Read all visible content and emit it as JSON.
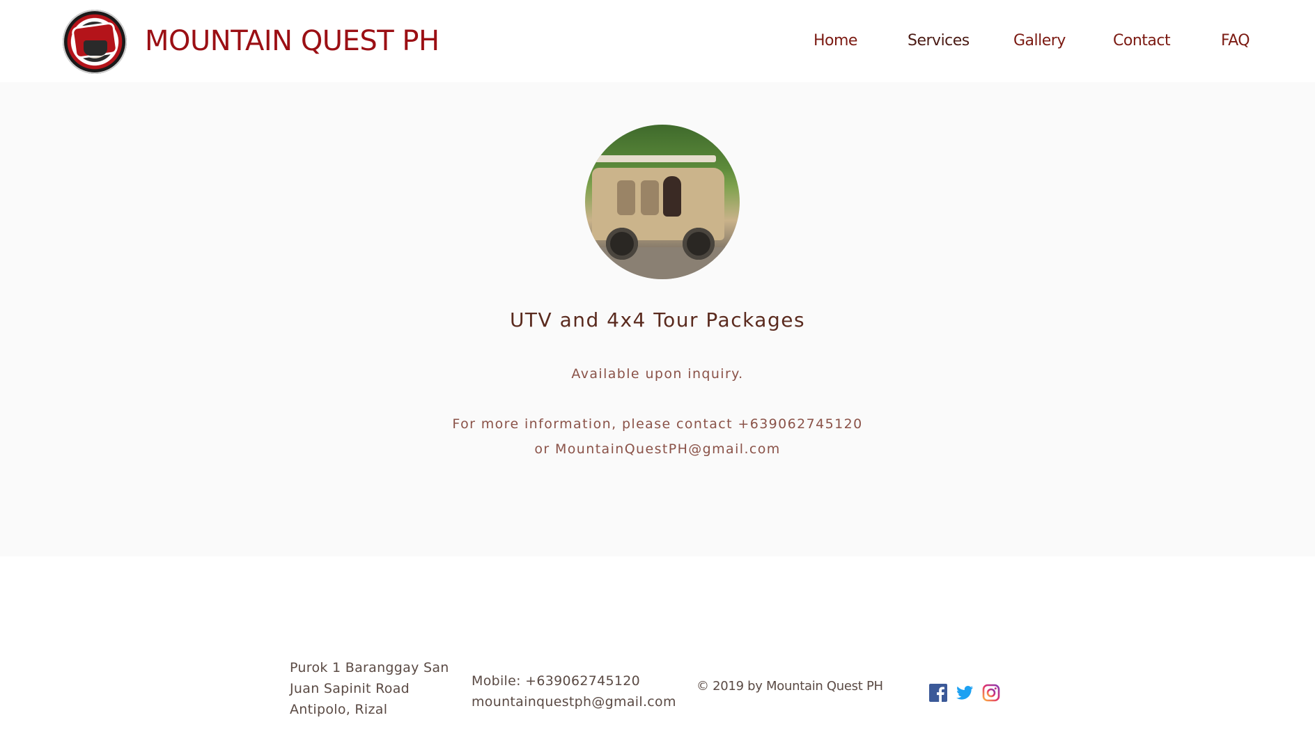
{
  "site": {
    "title": "MOUNTAIN QUEST PH",
    "brand_color": "#9b0f14",
    "logo_icon": "mountain-quest-logo"
  },
  "nav": {
    "items": [
      {
        "label": "Home"
      },
      {
        "label": "Services"
      },
      {
        "label": "Gallery"
      },
      {
        "label": "Contact"
      },
      {
        "label": "FAQ"
      }
    ]
  },
  "main": {
    "photo_alt": "UTV vehicle photo",
    "title": "UTV and 4x4 Tour Packages",
    "availability": "Available upon inquiry.",
    "more_info_line1": "For more information, please contact +639062745120",
    "more_info_line2": "or MountainQuestPH@gmail.com"
  },
  "footer": {
    "address": [
      "Purok 1 Baranggay San",
      "Juan Sapinit Road",
      "Antipolo, Rizal"
    ],
    "mobile": "Mobile: +639062745120",
    "email": "mountainquestph@gmail.com",
    "copyright": "© 2019 by Mountain Quest PH",
    "social": [
      {
        "icon": "facebook-icon",
        "color": "#3b5998"
      },
      {
        "icon": "twitter-icon",
        "color": "#1da1f2"
      },
      {
        "icon": "instagram-icon",
        "color": "#d6249f"
      }
    ]
  }
}
